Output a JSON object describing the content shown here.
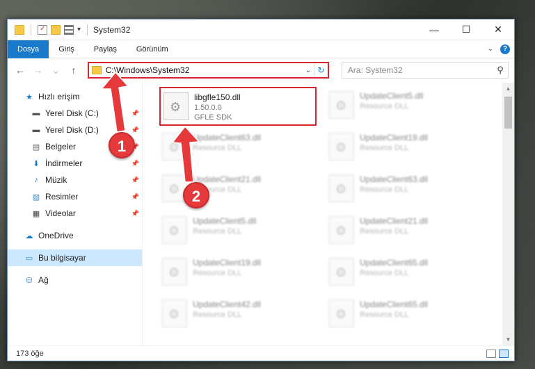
{
  "window": {
    "title": "System32"
  },
  "ribbon": {
    "tabs": [
      {
        "label": "Dosya"
      },
      {
        "label": "Giriş"
      },
      {
        "label": "Paylaş"
      },
      {
        "label": "Görünüm"
      }
    ]
  },
  "address": {
    "path": "C:\\Windows\\System32"
  },
  "search": {
    "placeholder": "Ara: System32"
  },
  "sidebar": {
    "quick_access": "Hızlı erişim",
    "items": [
      {
        "label": "Yerel Disk (C:)"
      },
      {
        "label": "Yerel Disk (D:)"
      },
      {
        "label": "Belgeler"
      },
      {
        "label": "İndirmeler"
      },
      {
        "label": "Müzik"
      },
      {
        "label": "Resimler"
      },
      {
        "label": "Videolar"
      }
    ],
    "onedrive": "OneDrive",
    "this_pc": "Bu bilgisayar",
    "network": "Ağ"
  },
  "files": {
    "target": {
      "name": "libgfle150.dll",
      "version": "1.50.0.0",
      "company": "GFLE SDK"
    },
    "left_column": [
      {
        "name": "UpdateClient63.dll",
        "type": "Resource DLL"
      },
      {
        "name": "UpdateClient21.dll",
        "type": "Resource DLL"
      },
      {
        "name": "UpdateClient5.dll",
        "type": "Resource DLL"
      },
      {
        "name": "UpdateClient19.dll",
        "type": "Resource DLL"
      },
      {
        "name": "UpdateClient42.dll",
        "type": "Resource DLL"
      }
    ],
    "right_column": [
      {
        "name": "UpdateClient5.dll",
        "type": "Resource DLL"
      },
      {
        "name": "UpdateClient19.dll",
        "type": "Resource DLL"
      },
      {
        "name": "UpdateClient63.dll",
        "type": "Resource DLL"
      },
      {
        "name": "UpdateClient21.dll",
        "type": "Resource DLL"
      },
      {
        "name": "UpdateClient65.dll",
        "type": "Resource DLL"
      },
      {
        "name": "UpdateClient65.dll",
        "type": "Resource DLL"
      }
    ]
  },
  "status": {
    "count": "173 öğe"
  },
  "markers": {
    "first": "1",
    "second": "2"
  },
  "colors": {
    "accent": "#1979ca",
    "highlight": "#d9242d",
    "marker": "#e5393b",
    "selected": "#cce8ff"
  }
}
